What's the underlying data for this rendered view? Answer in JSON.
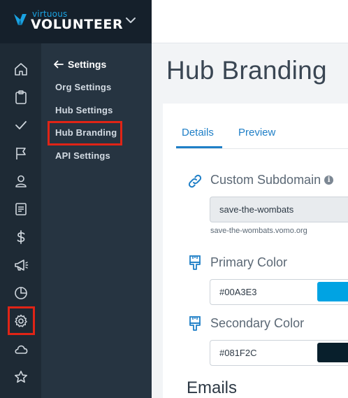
{
  "brand": {
    "small": "virtuous",
    "big": "VOLUNTEER"
  },
  "nav_rail": [
    "home-icon",
    "clipboard-icon",
    "checkmark-icon",
    "flag-icon",
    "person-icon",
    "document-icon",
    "dollar-icon",
    "megaphone-icon",
    "pie-chart-icon",
    "gear-icon",
    "cloud-icon",
    "star-icon"
  ],
  "submenu": {
    "back_label": "Settings",
    "items": [
      {
        "label": "Org Settings"
      },
      {
        "label": "Hub Settings"
      },
      {
        "label": "Hub Branding",
        "highlighted": true
      },
      {
        "label": "API Settings"
      }
    ]
  },
  "page": {
    "title": "Hub Branding",
    "tabs": [
      {
        "label": "Details",
        "active": true
      },
      {
        "label": "Preview",
        "active": false
      }
    ]
  },
  "fields": {
    "subdomain": {
      "label": "Custom Subdomain",
      "value": "save-the-wombats",
      "helper": "save-the-wombats.vomo.org"
    },
    "primary": {
      "label": "Primary Color",
      "value": "#00A3E3"
    },
    "secondary": {
      "label": "Secondary Color",
      "value": "#081F2C"
    }
  },
  "next_section": "Emails",
  "colors": {
    "accent": "#1F7FC7",
    "highlight": "#E02416",
    "primary_swatch": "#00A3E3",
    "secondary_swatch": "#081F2C"
  }
}
